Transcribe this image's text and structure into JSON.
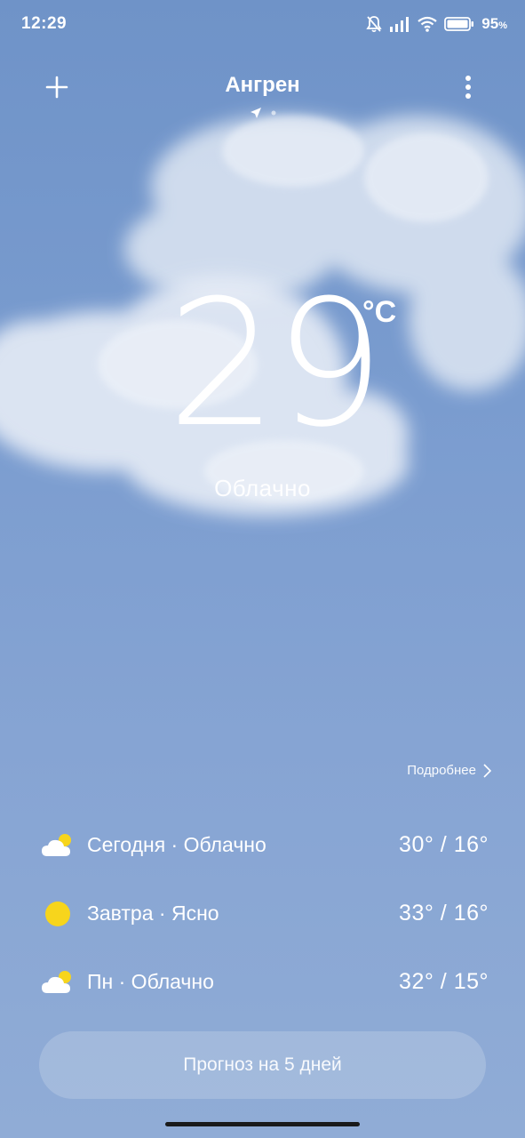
{
  "status_bar": {
    "time": "12:29",
    "battery_percent": "95",
    "battery_unit": "%",
    "icons": [
      "bell-off-icon",
      "signal-icon",
      "wifi-icon",
      "battery-icon"
    ]
  },
  "header": {
    "city": "Ангрен",
    "add_icon": "plus-icon",
    "menu_icon": "more-vertical-icon",
    "location_icon": "location-arrow-icon"
  },
  "current": {
    "temperature": "29",
    "unit": "°C",
    "condition": "Облачно"
  },
  "details_link": "Подробнее",
  "forecast": [
    {
      "label": "Сегодня · Облачно",
      "temps": "30° / 16°",
      "icon": "partly-cloudy-icon"
    },
    {
      "label": "Завтра · Ясно",
      "temps": "33° / 16°",
      "icon": "sun-icon"
    },
    {
      "label": "Пн · Облачно",
      "temps": "32° / 15°",
      "icon": "partly-cloudy-icon"
    }
  ],
  "forecast_button": "Прогноз на 5 дней",
  "colors": {
    "background_top": "#6f93c8",
    "background_bottom": "#90acd6",
    "sun": "#f7d51c"
  }
}
